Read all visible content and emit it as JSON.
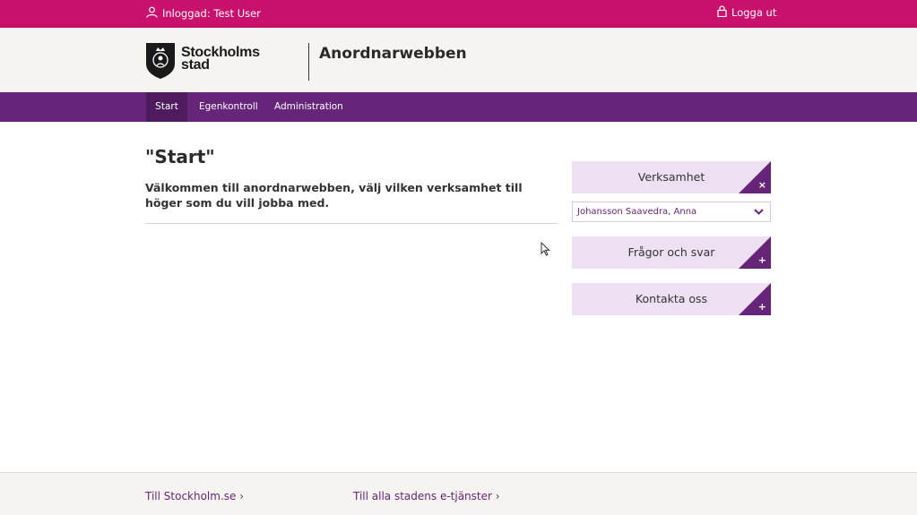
{
  "topbar": {
    "user_label": "Inloggad: Test User",
    "logout_label": "Logga ut"
  },
  "header": {
    "logo_line1": "Stockholms",
    "logo_line2": "stad",
    "app_title": "Anordnarwebben"
  },
  "nav": {
    "items": [
      {
        "label": "Start",
        "active": true
      },
      {
        "label": "Egenkontroll",
        "active": false
      },
      {
        "label": "Administration",
        "active": false
      }
    ]
  },
  "main": {
    "title": "\"Start\"",
    "intro": "Välkommen till anordnarwebben, välj vilken verksamhet till höger som du vill jobba med."
  },
  "sidebar": {
    "verksamhet_label": "Verksamhet",
    "selected_value": "Johansson Saavedra, Anna",
    "faq_label": "Frågor och svar",
    "contact_label": "Kontakta oss"
  },
  "footer": {
    "link1": "Till Stockholm.se ›",
    "link2": "Till alla stadens e-tjänster ›"
  },
  "colors": {
    "topbar": "#c8106d",
    "nav": "#67257a",
    "nav_active": "#4e1b5e",
    "side_button": "#ede0f2",
    "header_bg": "#f5f4f1"
  }
}
